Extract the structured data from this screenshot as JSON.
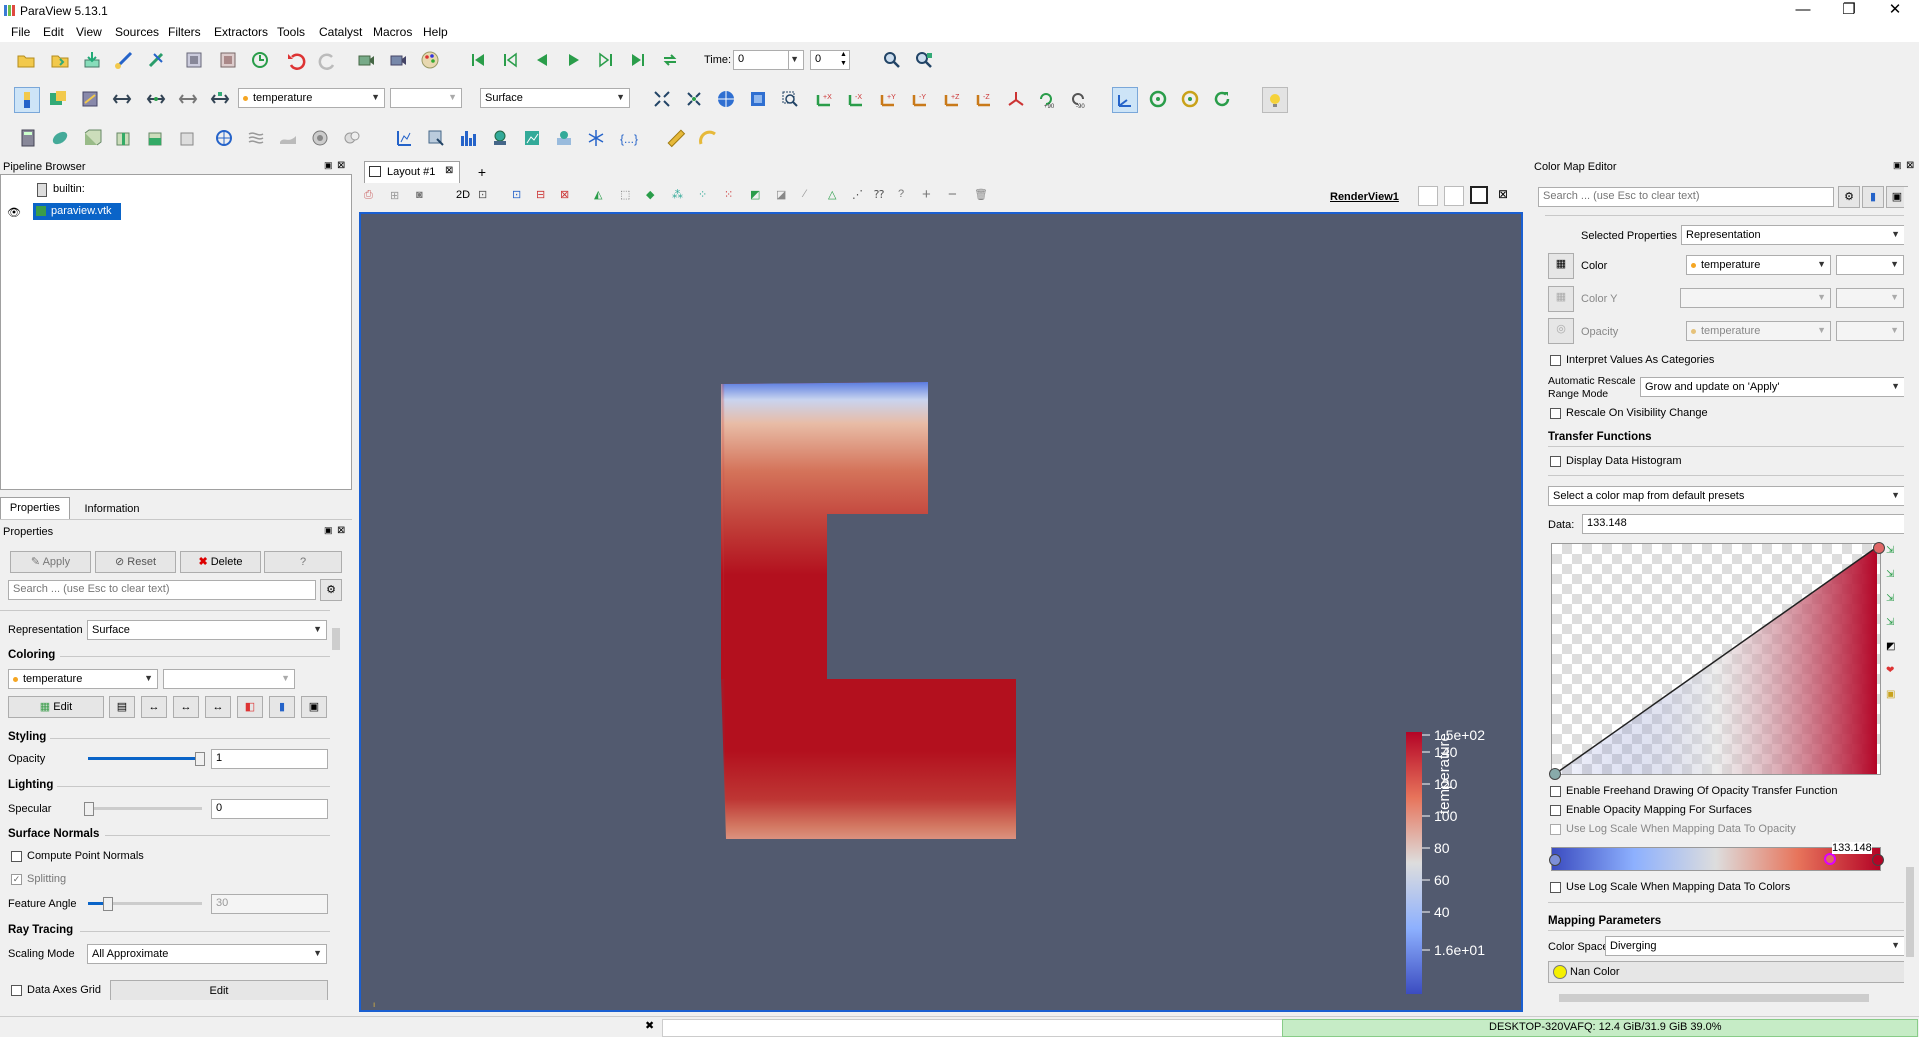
{
  "window": {
    "title": "ParaView 5.13.1",
    "minimize": "—",
    "maximize": "❐",
    "close": "✕"
  },
  "menu": [
    "File",
    "Edit",
    "View",
    "Sources",
    "Filters",
    "Extractors",
    "Tools",
    "Catalyst",
    "Macros",
    "Help"
  ],
  "time": {
    "label": "Time:",
    "value": "0",
    "index": "0"
  },
  "coloring_combo": "temperature",
  "component_combo": "",
  "representation_combo": "Surface",
  "pipeline": {
    "title": "Pipeline Browser",
    "items": [
      "builtin:",
      "paraview.vtk"
    ]
  },
  "properties": {
    "tabs": [
      "Properties",
      "Information"
    ],
    "title": "Properties",
    "apply": "Apply",
    "reset": "Reset",
    "delete": "Delete",
    "help": "?",
    "search_placeholder": "Search ... (use Esc to clear text)",
    "representation_label": "Representation",
    "representation_value": "Surface",
    "coloring_section": "Coloring",
    "coloring_value": "temperature",
    "edit": "Edit",
    "styling_section": "Styling",
    "opacity_label": "Opacity",
    "opacity_value": "1",
    "lighting_section": "Lighting",
    "specular_label": "Specular",
    "specular_value": "0",
    "surface_normals_section": "Surface Normals",
    "compute_normals": "Compute Point Normals",
    "splitting": "Splitting",
    "feature_angle_label": "Feature Angle",
    "feature_angle_value": "30",
    "ray_tracing_section": "Ray Tracing",
    "scaling_mode_label": "Scaling Mode",
    "scaling_mode_value": "All Approximate",
    "data_axes_grid": "Data Axes Grid",
    "data_axes_edit": "Edit",
    "opacity_level": 0.97,
    "specular_level": 0.0,
    "feature_angle_level": 0.17
  },
  "layout": {
    "tab": "Layout #1",
    "add": "+",
    "view_name": "RenderView1",
    "mode_2d": "2D"
  },
  "colorbar": {
    "title": "temperature",
    "ticks": [
      "1.5e+02",
      "140",
      "120",
      "100",
      "80",
      "60",
      "40",
      "1.6e+01"
    ]
  },
  "cme": {
    "title": "Color Map Editor",
    "search_placeholder": "Search ... (use Esc to clear text)",
    "selected_properties_label": "Selected Properties",
    "selected_properties_value": "Representation",
    "color_label": "Color",
    "color_value": "temperature",
    "color_y_label": "Color Y",
    "opacity_label": "Opacity",
    "opacity_value": "temperature",
    "interpret": "Interpret Values As Categories",
    "auto_rescale_label": "Automatic Rescale\nRange Mode",
    "auto_rescale_value": "Grow and update on 'Apply'",
    "rescale_visibility": "Rescale On Visibility Change",
    "transfer_section": "Transfer Functions",
    "display_histogram": "Display Data Histogram",
    "preset_placeholder": "Select a color map from default presets",
    "data_label": "Data:",
    "data_value": "133.148",
    "freehand": "Enable Freehand Drawing Of Opacity Transfer Function",
    "opacity_surfaces": "Enable Opacity Mapping For Surfaces",
    "log_opacity": "Use Log Scale When Mapping Data To Opacity",
    "marker_value": "133.148",
    "log_colors": "Use Log Scale When Mapping Data To Colors",
    "mapping_section": "Mapping Parameters",
    "color_space_label": "Color Space",
    "color_space_value": "Diverging",
    "nan_color": "Nan Color"
  },
  "status": {
    "memory": "DESKTOP-320VAFQ: 12.4 GiB/31.9 GiB 39.0%"
  },
  "colors": {
    "render_bg": "#525a6f",
    "accent": "#1a5fd1",
    "shape_red": "#b3101e"
  }
}
